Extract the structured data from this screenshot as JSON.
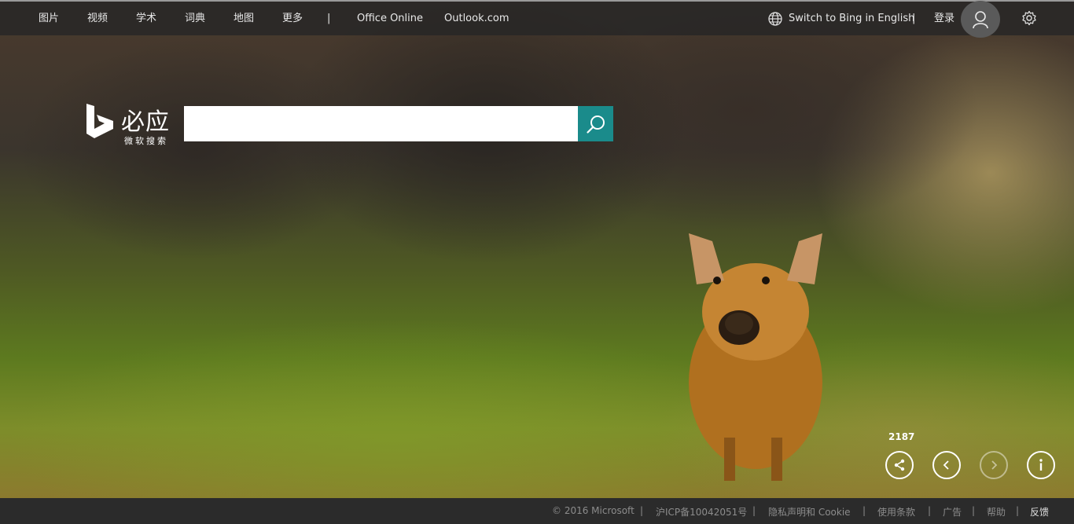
{
  "nav": {
    "links": [
      "图片",
      "视频",
      "学术",
      "词典",
      "地图",
      "更多"
    ],
    "separator": "|",
    "office": "Office Online",
    "outlook": "Outlook.com",
    "switch_lang": "Switch to Bing in English",
    "signin": "登录"
  },
  "logo": {
    "name": "必应",
    "subtitle": "微软搜索"
  },
  "search": {
    "value": "",
    "placeholder": ""
  },
  "image_controls": {
    "share_count": "2187"
  },
  "footer": {
    "copyright": "© 2016 Microsoft",
    "icp": "沪ICP备10042051号",
    "privacy": "隐私声明和 Cookie",
    "terms": "使用条款",
    "ads": "广告",
    "help": "帮助",
    "feedback": "反馈",
    "separator": "|"
  },
  "colors": {
    "search_button": "#1a8b8b",
    "topbar": "#262626",
    "footer": "#2b2b2b"
  }
}
